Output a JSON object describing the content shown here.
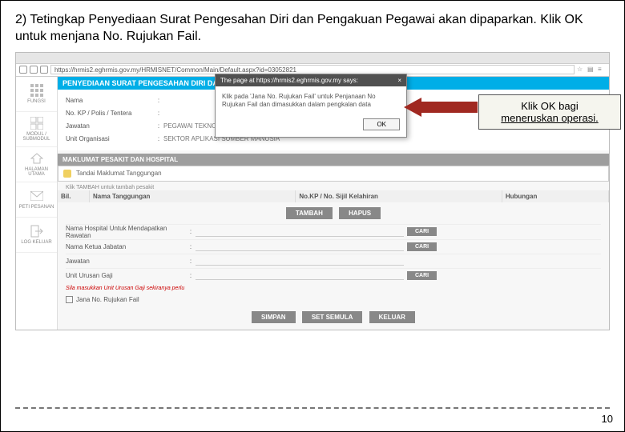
{
  "instruction": "2) Tetingkap Penyediaan Surat Pengesahan Diri dan Pengakuan Pegawai akan dipaparkan. Klik OK untuk menjana No. Rujukan Fail.",
  "url": "https://hrmis2.eghrmis.gov.my/HRMISNET/Common/Main/Default.aspx?id=03052821",
  "title_bar": "PENYEDIAAN SURAT PENGESAHAN DIRI DAN PENGAKUAN PEGAWAI",
  "form": {
    "nama": "Nama",
    "nokp": "No. KP / Polis / Tentera",
    "jawatan": "Jawatan",
    "jawatan_val": "PEGAWAI TEKNOLOGI MAKLUMAT",
    "unit": "Unit Organisasi",
    "unit_val": "SEKTOR APLIKASI SUMBER MANUSIA"
  },
  "section_hosp": "MAKLUMAT PESAKIT DAN HOSPITAL",
  "alert": "Tandai Maklumat Tanggungan",
  "klik": "Klik TAMBAH untuk tambah pesakit",
  "th": {
    "bil": "Bil.",
    "nama": "Nama Tanggungan",
    "nokp": "No.KP / No. Sijil Kelahiran",
    "hub": "Hubungan"
  },
  "btn": {
    "tambah": "TAMBAH",
    "hapus": "HAPUS",
    "cari": "CARI",
    "simpan": "SIMPAN",
    "set": "SET SEMULA",
    "keluar": "KELUAR"
  },
  "hosp": {
    "nama_hosp": "Nama Hospital Untuk Mendapatkan Rawatan",
    "ketua": "Nama Ketua Jabatan",
    "jawatan": "Jawatan",
    "unit_gaji": "Unit Urusan Gaji"
  },
  "note": "Sila masukkan Unit Urusan Gaji sekiranya perlu",
  "checkbox": "Jana No. Rujukan Fail",
  "sidebar": {
    "fungsi": "FUNGSI",
    "submodul": "MODUL / SUBMODUL",
    "halaman": "HALAMAN UTAMA",
    "pesanan": "PETI PESANAN",
    "log": "LOG KELUAR"
  },
  "dialog": {
    "title": "The page at https://hrmis2.eghrmis.gov.my says:",
    "close": "×",
    "body": "Klik pada 'Jana No. Rujukan Fail' untuk Penjanaan No Rujukan Fail dan dimasukkan dalam pengkalan data",
    "ok": "OK"
  },
  "callout": {
    "l1": "Klik OK bagi",
    "l2": "meneruskan operasi."
  },
  "page": "10"
}
